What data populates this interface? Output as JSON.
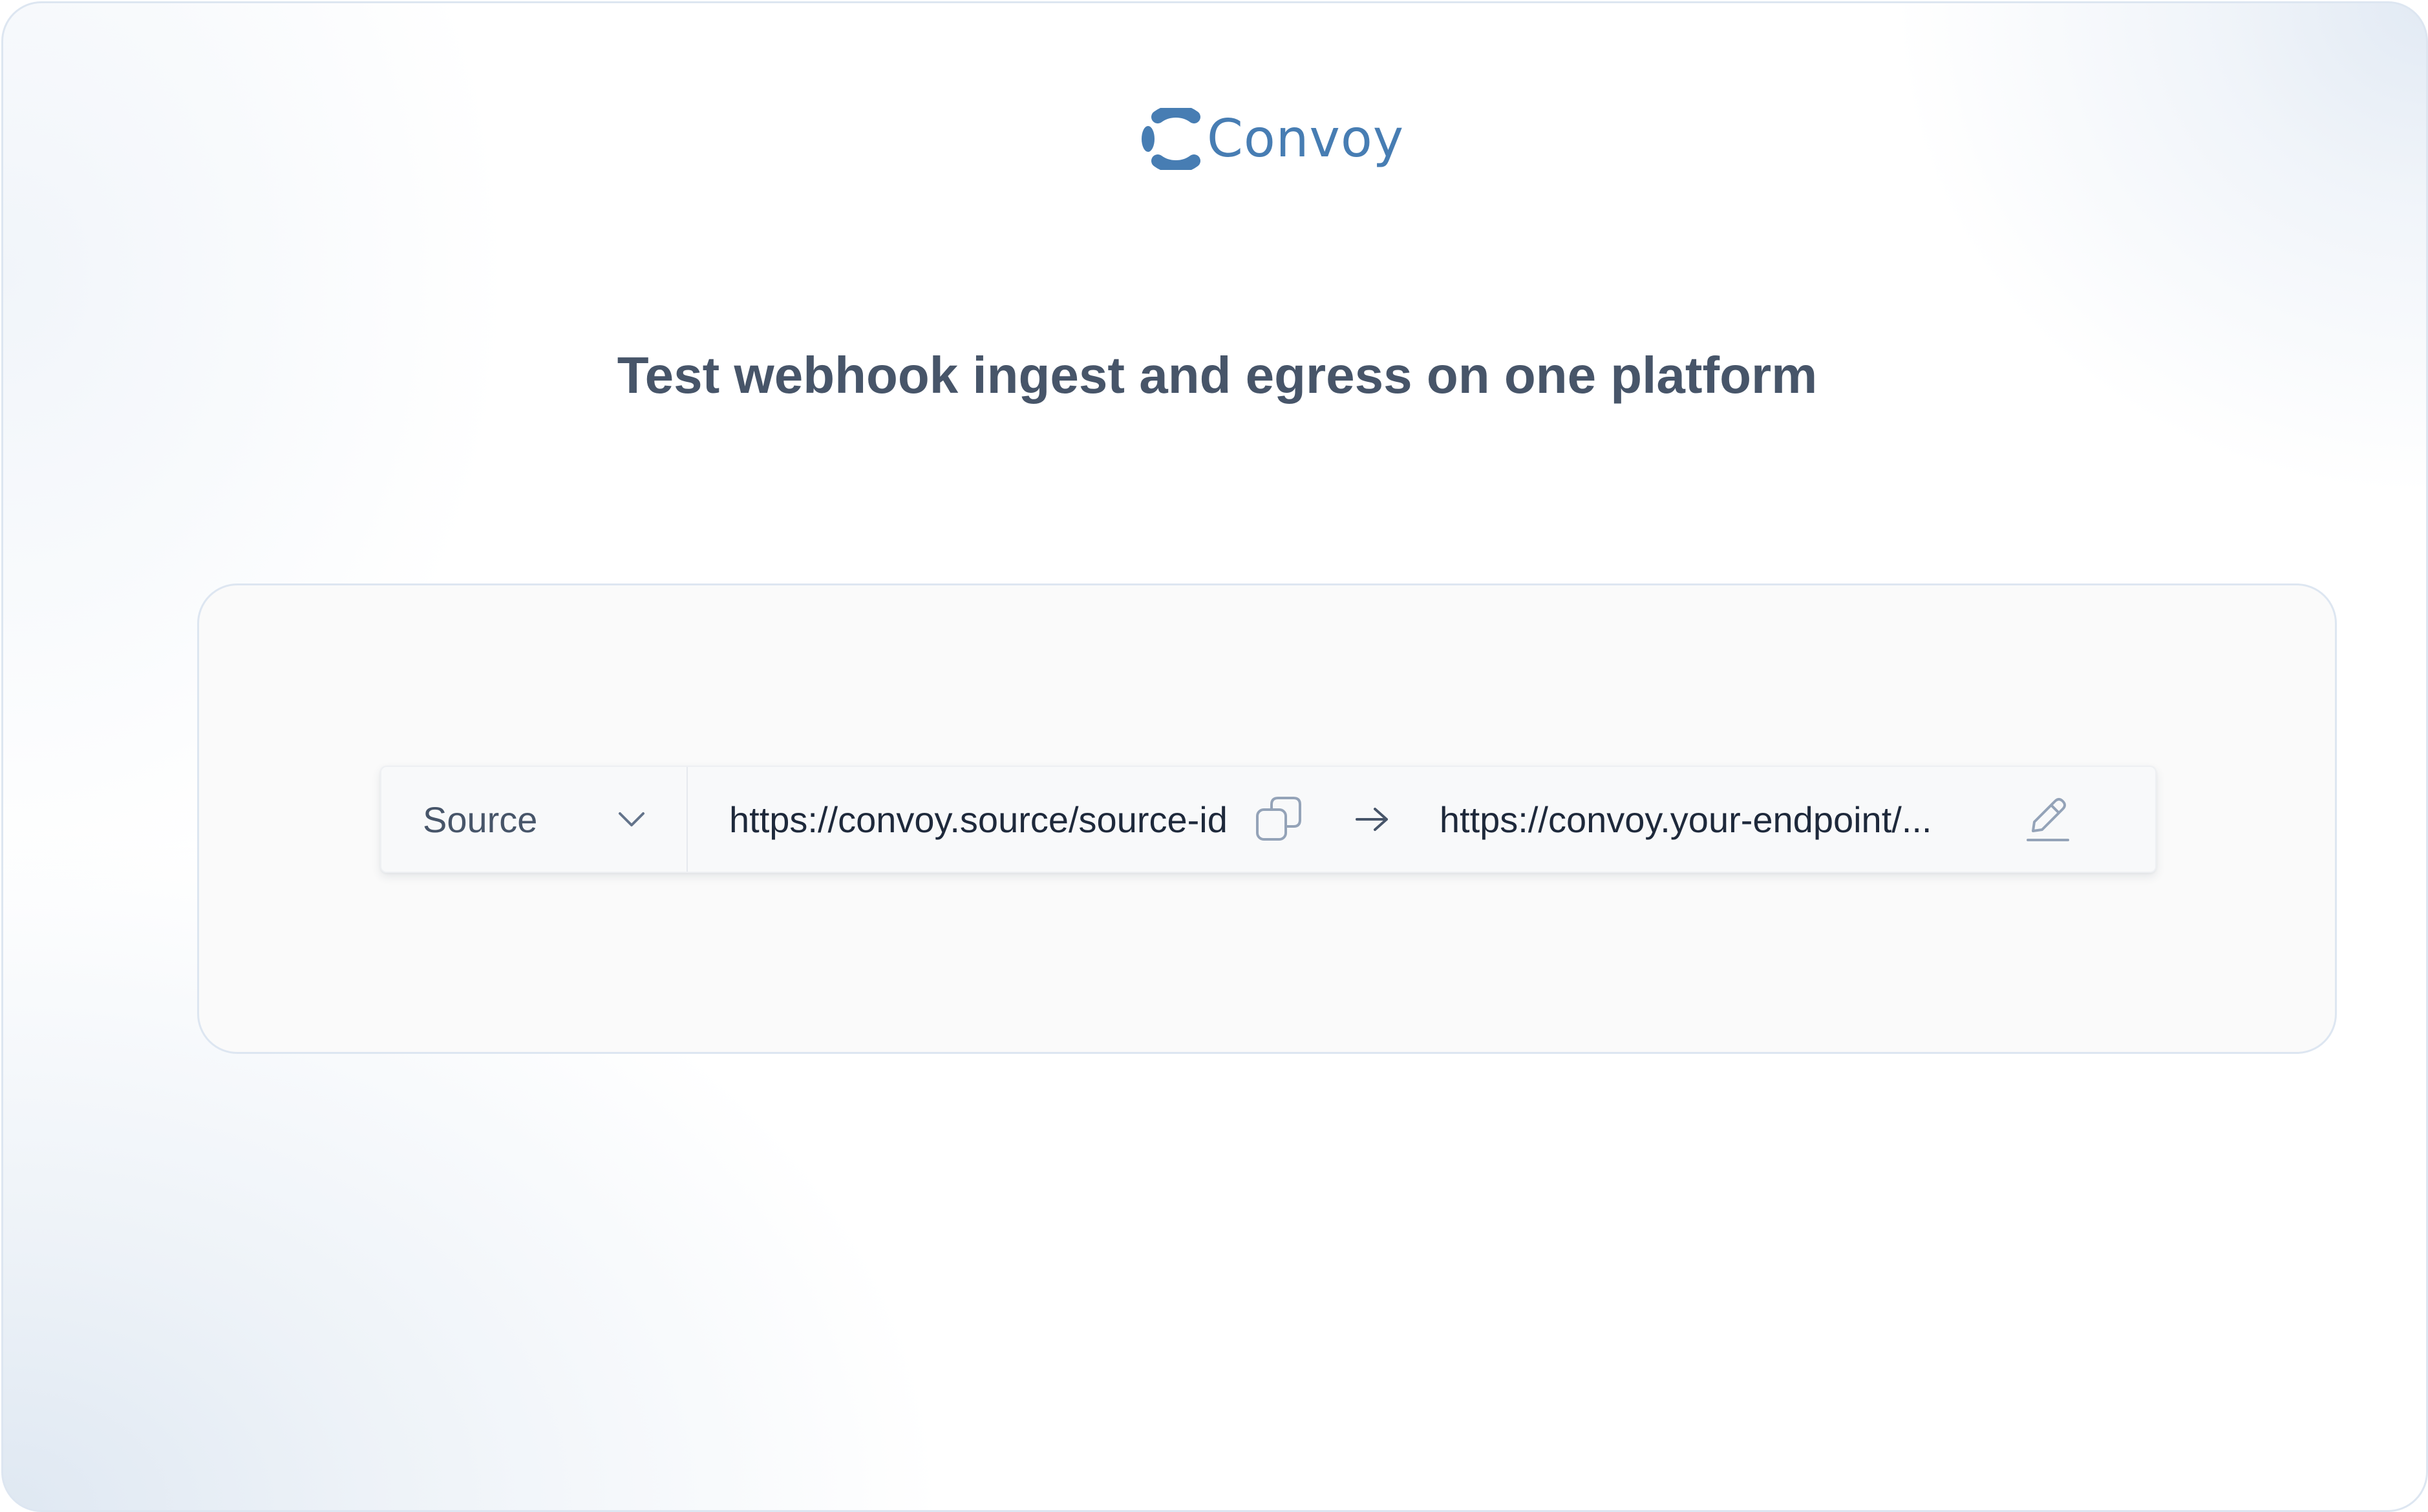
{
  "brand": {
    "name": "Convoy",
    "logo_icon": "convoy-logo-icon",
    "color": "#477db3"
  },
  "hero": {
    "headline": "Test webhook ingest and egress on one platform"
  },
  "pipeline": {
    "source_select": {
      "selected": "Source",
      "icon": "chevron-down-icon"
    },
    "source_url": "https://convoy.source/source-id",
    "copy_icon": "copy-icon",
    "arrow_icon": "arrow-right-icon",
    "endpoint_url": "https://convoy.your-endpoint/...",
    "edit_icon": "pencil-icon"
  },
  "colors": {
    "heading": "#475569",
    "text": "#1e293b",
    "border": "#dde6f1",
    "icon": "#94a3b8"
  }
}
